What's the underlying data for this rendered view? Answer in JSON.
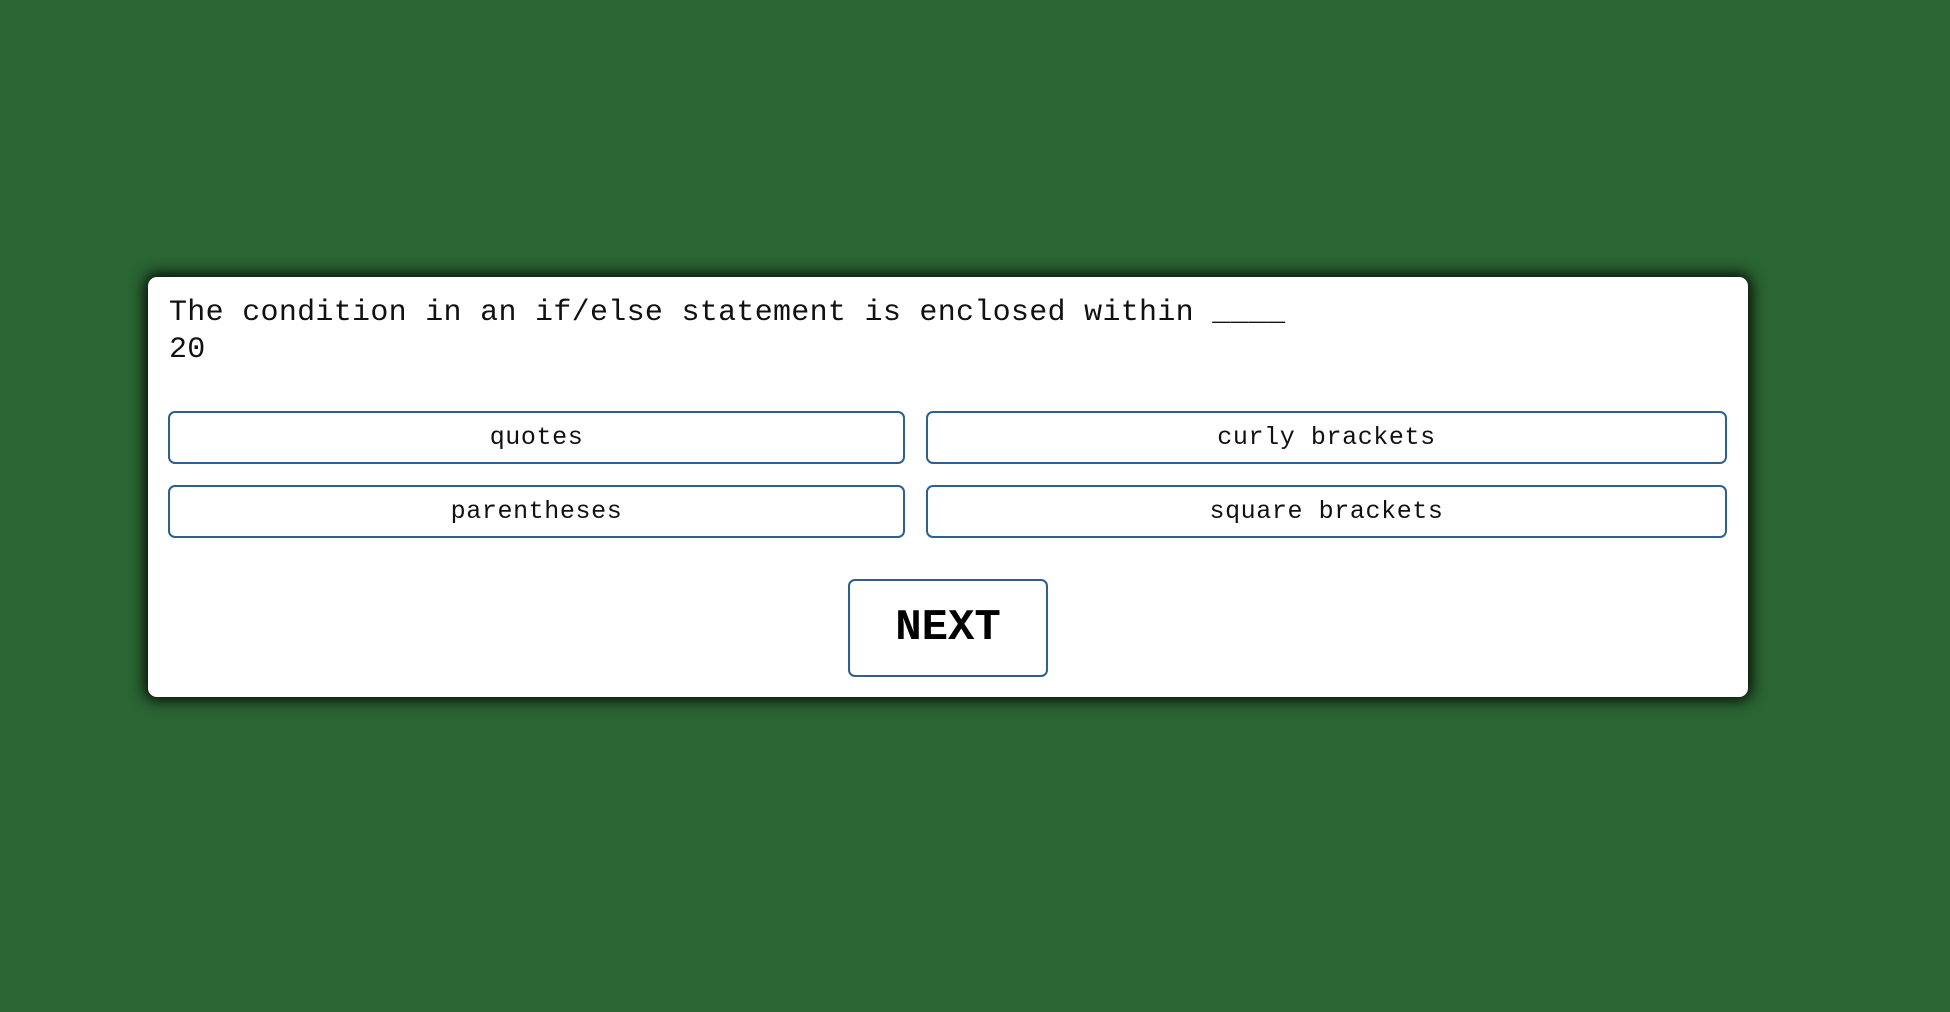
{
  "colors": {
    "background": "#2b6533",
    "card": "#ffffff",
    "button_border": "#2d5f8f",
    "text": "#111111"
  },
  "quiz": {
    "question": "The condition in an if/else statement is enclosed within ____",
    "score": "20",
    "answers": [
      "quotes",
      "curly brackets",
      "parentheses",
      "square brackets"
    ],
    "next_label": "NEXT"
  }
}
